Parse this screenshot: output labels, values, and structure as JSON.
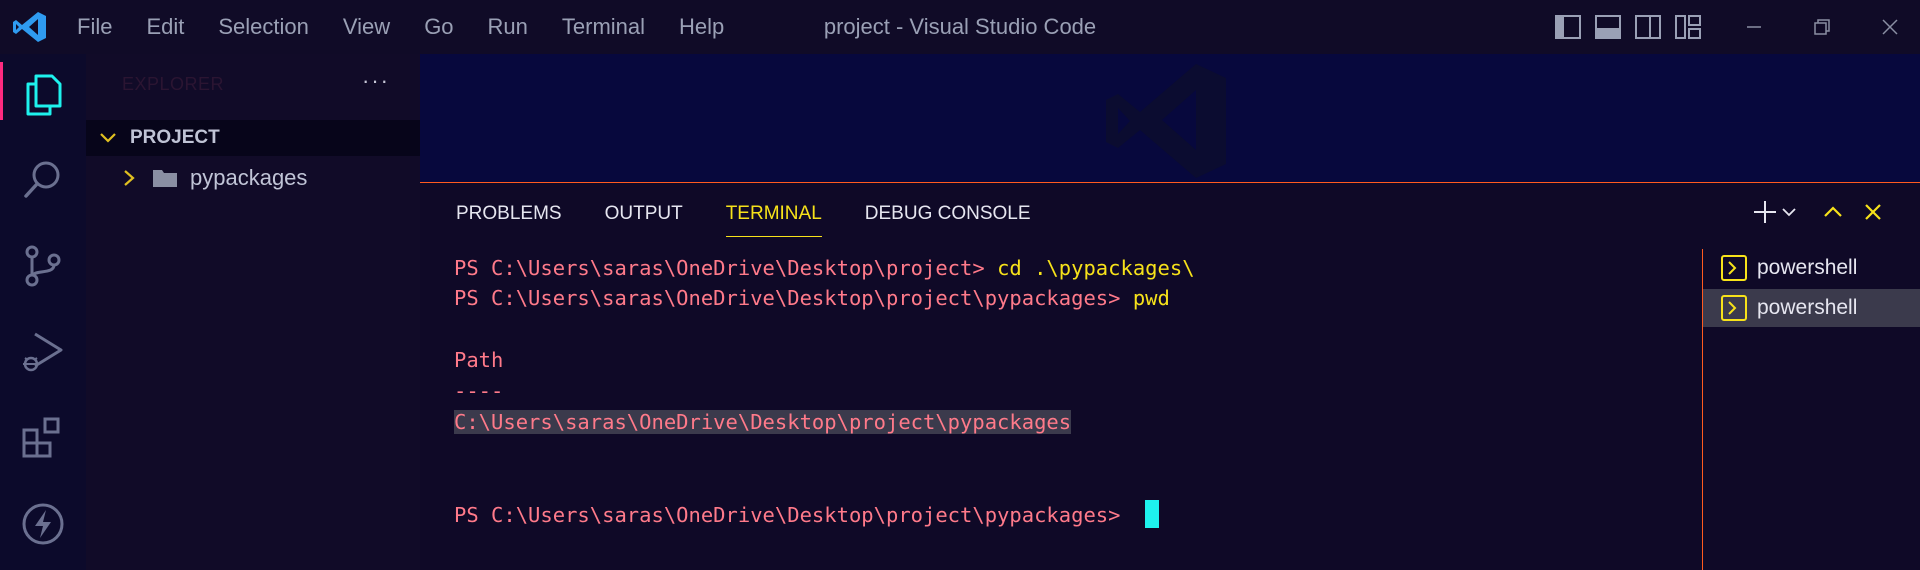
{
  "titlebar": {
    "menu": [
      "File",
      "Edit",
      "Selection",
      "View",
      "Go",
      "Run",
      "Terminal",
      "Help"
    ],
    "window_title": "project - Visual Studio Code"
  },
  "activity_bar": {
    "items": [
      "explorer-icon",
      "search-icon",
      "source-control-icon",
      "run-debug-icon",
      "extensions-icon",
      "lightning-icon"
    ]
  },
  "sidebar": {
    "header": "EXPLORER",
    "more": "···",
    "section_title": "PROJECT",
    "folders": [
      {
        "label": "pypackages"
      }
    ]
  },
  "panel": {
    "tabs": [
      "PROBLEMS",
      "OUTPUT",
      "TERMINAL",
      "DEBUG CONSOLE"
    ],
    "active_tab": "TERMINAL"
  },
  "terminal": {
    "lines": [
      {
        "prompt": "PS C:\\Users\\saras\\OneDrive\\Desktop\\project> ",
        "cmd": "cd .\\pypackages\\"
      },
      {
        "prompt": "PS C:\\Users\\saras\\OneDrive\\Desktop\\project\\pypackages> ",
        "cmd": "pwd"
      },
      {
        "text": "Path"
      },
      {
        "text": "----"
      },
      {
        "text": "C:\\Users\\saras\\OneDrive\\Desktop\\project\\pypackages"
      },
      {
        "prompt": "PS C:\\Users\\saras\\OneDrive\\Desktop\\project\\pypackages> "
      }
    ]
  },
  "terminal_list": [
    {
      "label": "powershell",
      "active": false
    },
    {
      "label": "powershell",
      "active": true
    }
  ],
  "colors": {
    "accent_orange": "#ff5a1f",
    "terminal_yellow": "#f7e21a",
    "terminal_pink": "#ff7a8a",
    "cursor_cyan": "#1ef2ee",
    "active_bar_pink": "#ff2a7f"
  }
}
